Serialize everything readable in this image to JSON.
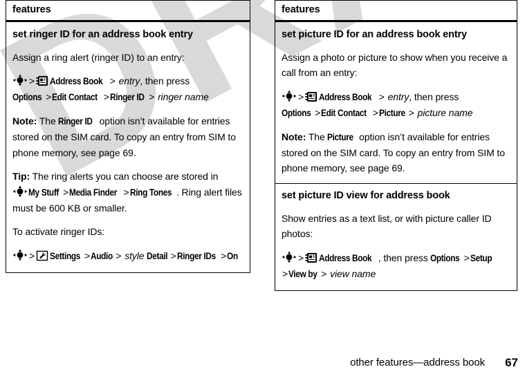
{
  "document": {
    "watermark": "DRAFT",
    "footer": {
      "section_title": "other features—address book",
      "page_number": "67"
    }
  },
  "columns": {
    "left": {
      "header": "features",
      "sections": [
        {
          "title": "set ringer ID for an address book entry",
          "intro": "Assign a ring alert (ringer ID) to an entry:",
          "path_line1_pre": ">",
          "path_line1_menu": "Address Book",
          "path_line1_gt": ">",
          "path_line1_italic": "entry",
          "path_line1_post": ", then press",
          "path_line2": [
            "Options",
            ">",
            "Edit Contact",
            ">",
            "Ringer ID",
            ">"
          ],
          "path_line2_italic": "ringer name",
          "note_label": "Note:",
          "note_pre": "The",
          "note_bold": "Ringer ID",
          "note_post": "option isn’t available for entries stored on the SIM card. To copy an entry from SIM to phone memory, see page 69.",
          "tip_label": "Tip:",
          "tip_pre": "The ring alerts you can choose are stored in",
          "tip_menu": [
            "My Stuff",
            ">",
            "Media Finder",
            ">",
            "Ring Tones"
          ],
          "tip_post": ". Ring alert files must be 600 KB or smaller.",
          "activate_intro": "To activate ringer IDs:",
          "activate_path": [
            "Settings",
            ">",
            "Audio",
            ">"
          ],
          "activate_italic": "style",
          "activate_path2": [
            "Detail",
            ">",
            "Ringer IDs",
            ">",
            "On"
          ]
        }
      ]
    },
    "right": {
      "header": "features",
      "sections": [
        {
          "title": "set picture ID for an address book entry",
          "intro": "Assign a photo or picture to show when you receive a call from an entry:",
          "path_line1_pre": ">",
          "path_line1_menu": "Address Book",
          "path_line1_gt": ">",
          "path_line1_italic": "entry",
          "path_line1_post": ", then press",
          "path_line2": [
            "Options",
            ">",
            "Edit Contact",
            ">",
            "Picture",
            ">"
          ],
          "path_line2_italic": "picture name",
          "note_label": "Note:",
          "note_pre": "The",
          "note_bold": "Picture",
          "note_post": "option isn’t available for entries stored on the SIM card. To copy an entry from SIM to phone memory, see page 69."
        },
        {
          "title": "set picture ID view for address book",
          "intro": "Show entries as a text list, or with picture caller ID photos:",
          "path_line1_pre": ">",
          "path_line1_menu": "Address Book",
          "path_line1_post": ", then press",
          "path_line1_menu2": [
            "Options",
            ">",
            "Setup"
          ],
          "path_line2": [
            ">",
            "View by",
            ">"
          ],
          "path_line2_italic": "view name"
        }
      ]
    }
  },
  "icons": {
    "nav_key": "navigation-key-icon",
    "address_book": "address-book-icon",
    "settings": "settings-wrench-icon"
  }
}
